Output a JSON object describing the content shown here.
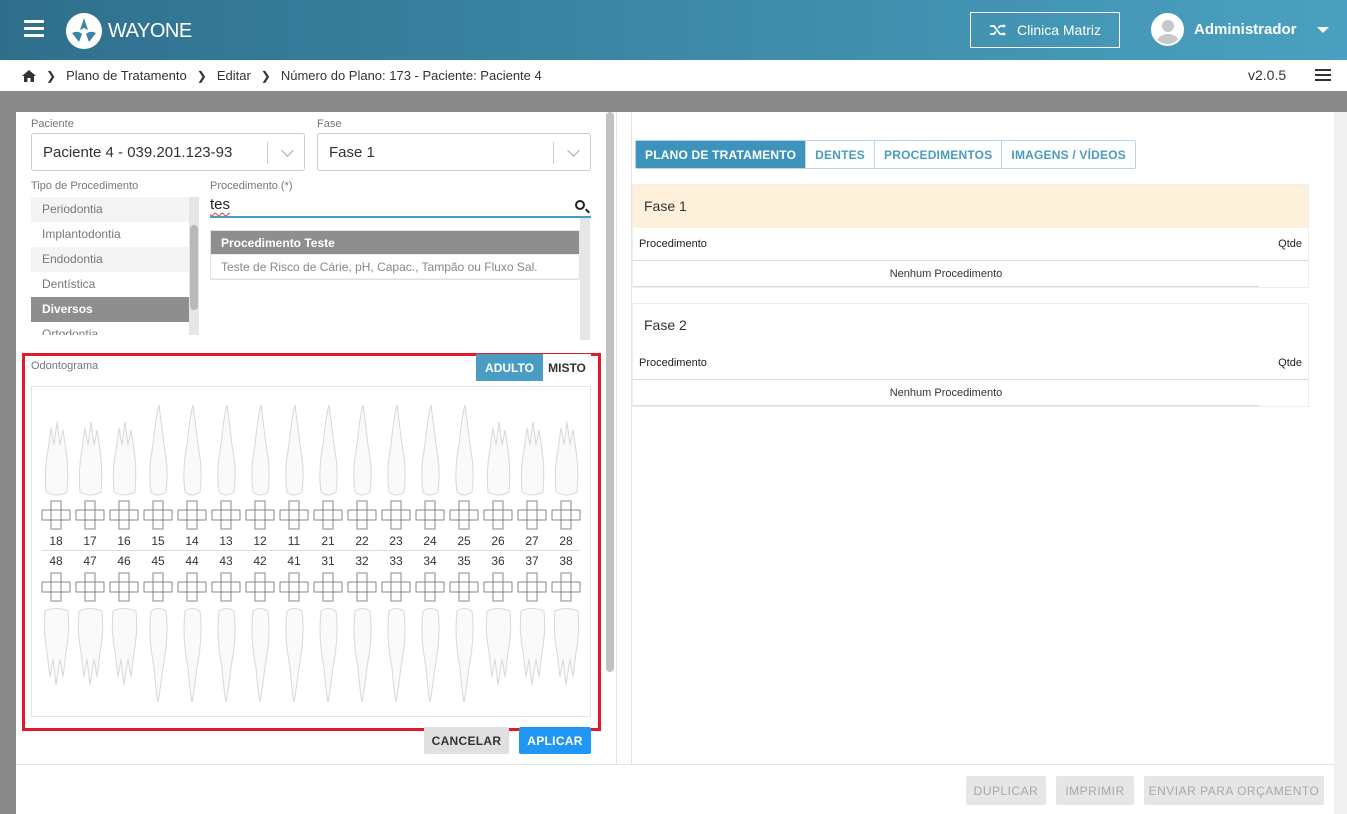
{
  "header": {
    "logo_text": "WAYONE",
    "clinic_label": "Clinica Matriz",
    "user_name": "Administrador"
  },
  "breadcrumb": {
    "items": [
      "Plano de Tratamento",
      "Editar",
      "Número do Plano: 173 - Paciente: Paciente 4"
    ],
    "version": "v2.0.5"
  },
  "form": {
    "patient_label": "Paciente",
    "patient_value": "Paciente 4 - 039.201.123-93",
    "phase_label": "Fase",
    "phase_value": "Fase 1",
    "type_label": "Tipo de Procedimento",
    "types": [
      "Periodontia",
      "Implantodontia",
      "Endodontia",
      "Dentística",
      "Diversos",
      "Ortodontia"
    ],
    "selected_type": "Diversos",
    "procedure_label": "Procedimento (*)",
    "search_value": "tes",
    "procedures": [
      "Procedimento Teste",
      "Teste de Risco de Cárie, pH, Capac., Tampão ou Fluxo Sal."
    ]
  },
  "odontogram": {
    "label": "Odontograma",
    "toggle_adult": "ADULTO",
    "toggle_mixed": "MISTO",
    "upper_numbers": [
      "18",
      "17",
      "16",
      "15",
      "14",
      "13",
      "12",
      "11",
      "21",
      "22",
      "23",
      "24",
      "25",
      "26",
      "27",
      "28"
    ],
    "lower_numbers": [
      "48",
      "47",
      "46",
      "45",
      "44",
      "43",
      "42",
      "41",
      "31",
      "32",
      "33",
      "34",
      "35",
      "36",
      "37",
      "38"
    ],
    "cancel_label": "CANCELAR",
    "apply_label": "APLICAR"
  },
  "plan": {
    "tabs": [
      "PLANO DE TRATAMENTO",
      "DENTES",
      "PROCEDIMENTOS",
      "IMAGENS / VÍDEOS"
    ],
    "active_tab": "PLANO DE TRATAMENTO",
    "phases": [
      {
        "name": "Fase 1",
        "col_procedure": "Procedimento",
        "col_qty": "Qtde",
        "empty": "Nenhum Procedimento"
      },
      {
        "name": "Fase 2",
        "col_procedure": "Procedimento",
        "col_qty": "Qtde",
        "empty": "Nenhum Procedimento"
      }
    ]
  },
  "footer": {
    "duplicate": "DUPLICAR",
    "print": "IMPRIMIR",
    "send_budget": "ENVIAR PARA ORÇAMENTO"
  },
  "colors": {
    "accent": "#4a9cc2",
    "highlight_frame": "#e01c2a",
    "apply_button": "#2196f3"
  }
}
